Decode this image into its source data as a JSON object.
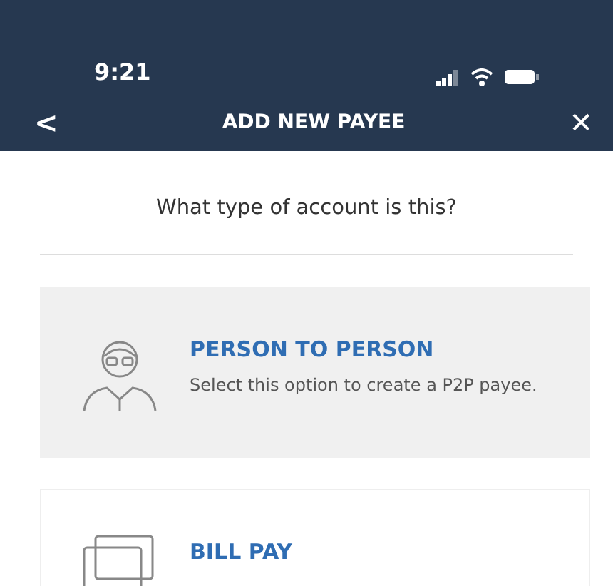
{
  "status_bar": {
    "time": "9:21"
  },
  "nav": {
    "back": "<",
    "title": "ADD NEW PAYEE",
    "close": "✕"
  },
  "question": "What type of account is this?",
  "options": [
    {
      "kind": "person",
      "title": "PERSON TO PERSON",
      "description": "Select this option to create a P2P payee.",
      "selected": true
    },
    {
      "kind": "bill",
      "title": "BILL PAY",
      "selected": false
    }
  ]
}
